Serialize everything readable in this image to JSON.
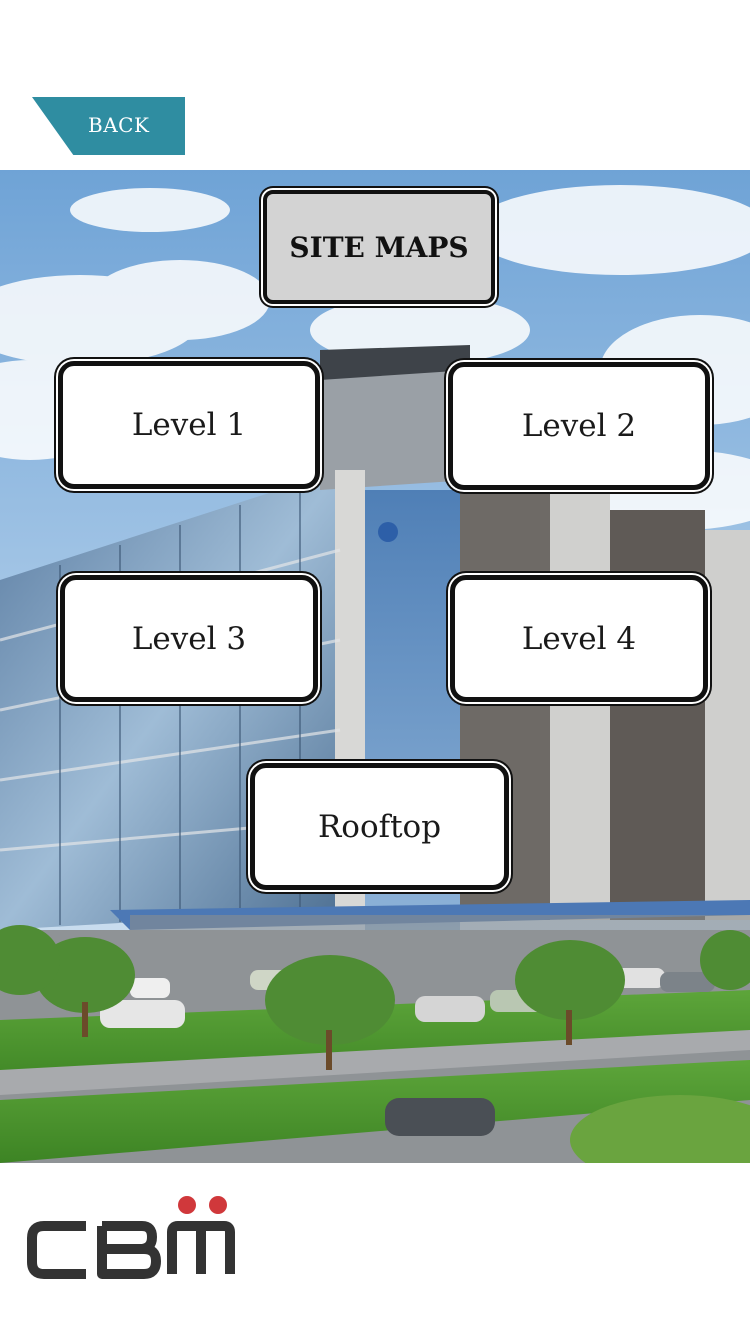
{
  "header": {
    "back_label": "BACK"
  },
  "title": "SITE MAPS",
  "levels": [
    {
      "label": "Level 1"
    },
    {
      "label": "Level 2"
    },
    {
      "label": "Level 3"
    },
    {
      "label": "Level 4"
    },
    {
      "label": "Rooftop"
    }
  ],
  "logo": {
    "text": "CBM",
    "accent_color": "#d0383b",
    "text_color": "#333333"
  },
  "colors": {
    "back_tab": "#2f8da1",
    "title_bg": "#d3d3d3"
  }
}
